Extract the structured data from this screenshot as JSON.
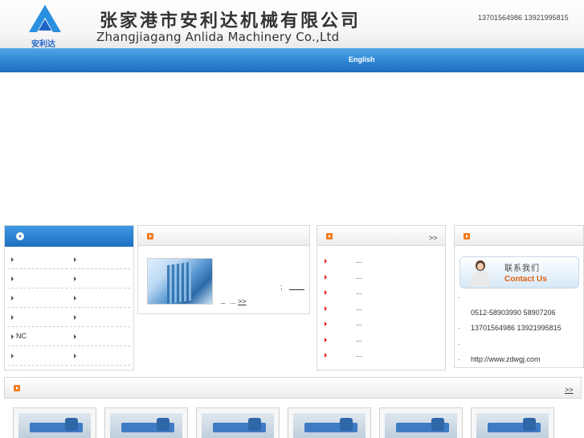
{
  "header": {
    "logo_text": "安利达",
    "company_cn": "张家港市安利达机械有限公司",
    "company_en": "Zhangjiagang Anlida Machinery Co.,Ltd",
    "phones": "13701564986 13921995815"
  },
  "nav": {
    "english": "English"
  },
  "categories": {
    "items": [
      "",
      "",
      "",
      "",
      "",
      "",
      "",
      "",
      "NC",
      "",
      "",
      ""
    ]
  },
  "about": {
    "sep": ";",
    "line2_a": "_",
    "line2_b": "...",
    "more": ">>"
  },
  "news": {
    "more": ">>",
    "items": [
      "...",
      "...",
      "...",
      "...",
      "...",
      "...",
      "..."
    ]
  },
  "contact": {
    "banner_cn": "联系我们",
    "banner_en": "Contact Us",
    "dots": [
      "·",
      "·",
      "·",
      "·"
    ],
    "tel": "0512-58903990 58907206",
    "mobile": "13701564986 13921995815",
    "web": "http://www.zdwgj.com"
  },
  "products": {
    "more": ">>"
  },
  "colors": {
    "nav_blue": "#2f86d2",
    "accent_orange": "#f07d1f",
    "bullet_red": "#e0221f"
  }
}
